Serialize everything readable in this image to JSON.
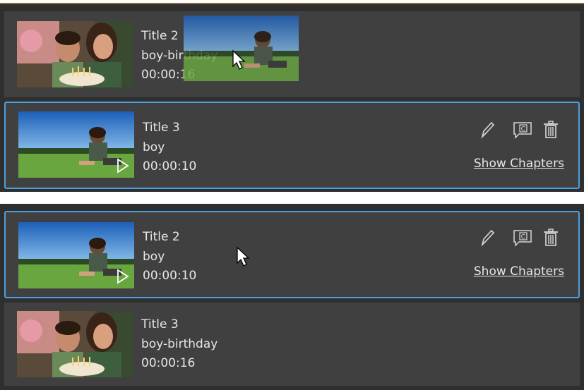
{
  "top_panel": {
    "rows": [
      {
        "title": "Title 2",
        "name": "boy-birthday",
        "duration": "00:00:16",
        "thumbnail": "birthday-thumbnail"
      },
      {
        "title": "Title 3",
        "name": "boy",
        "duration": "00:00:10",
        "thumbnail": "boy-field-thumbnail",
        "selected": true
      }
    ],
    "drag_ghost": {
      "thumbnail": "boy-field-thumbnail"
    }
  },
  "bottom_panel": {
    "rows": [
      {
        "title": "Title 2",
        "name": "boy",
        "duration": "00:00:10",
        "thumbnail": "boy-field-thumbnail",
        "selected": true
      },
      {
        "title": "Title 3",
        "name": "boy-birthday",
        "duration": "00:00:16",
        "thumbnail": "birthday-thumbnail"
      }
    ]
  },
  "actions": {
    "edit_icon": "pencil-icon",
    "chapter_icon": "chapter-c-icon",
    "delete_icon": "trash-icon",
    "show_chapters_label": "Show Chapters"
  },
  "colors": {
    "panel_bg": "#2f2f2f",
    "row_bg": "#404040",
    "selection_border": "#4a9fe0",
    "text": "#e6e6e6"
  }
}
